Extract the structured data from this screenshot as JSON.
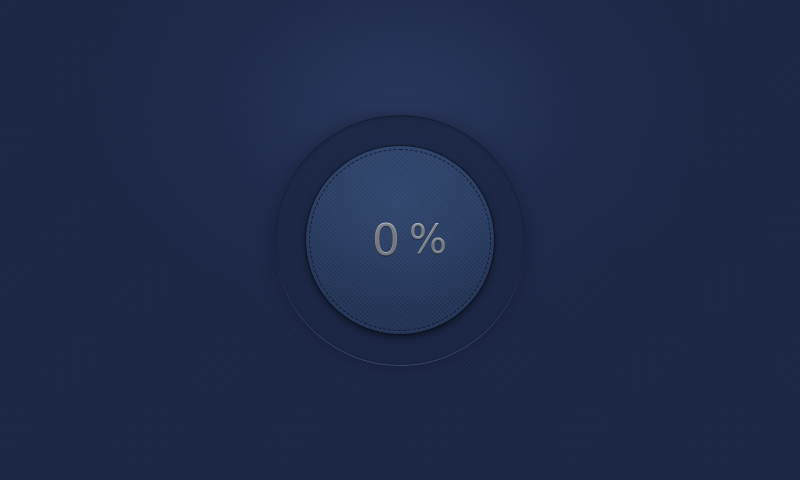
{
  "progress": {
    "value": "0",
    "unit": "%",
    "fraction": 0
  },
  "colors": {
    "background": "#1c2746",
    "ring": "#1b2644",
    "dial": "#24365a",
    "progress_fill": "#5a7bc0",
    "text": "#b4bac4"
  }
}
